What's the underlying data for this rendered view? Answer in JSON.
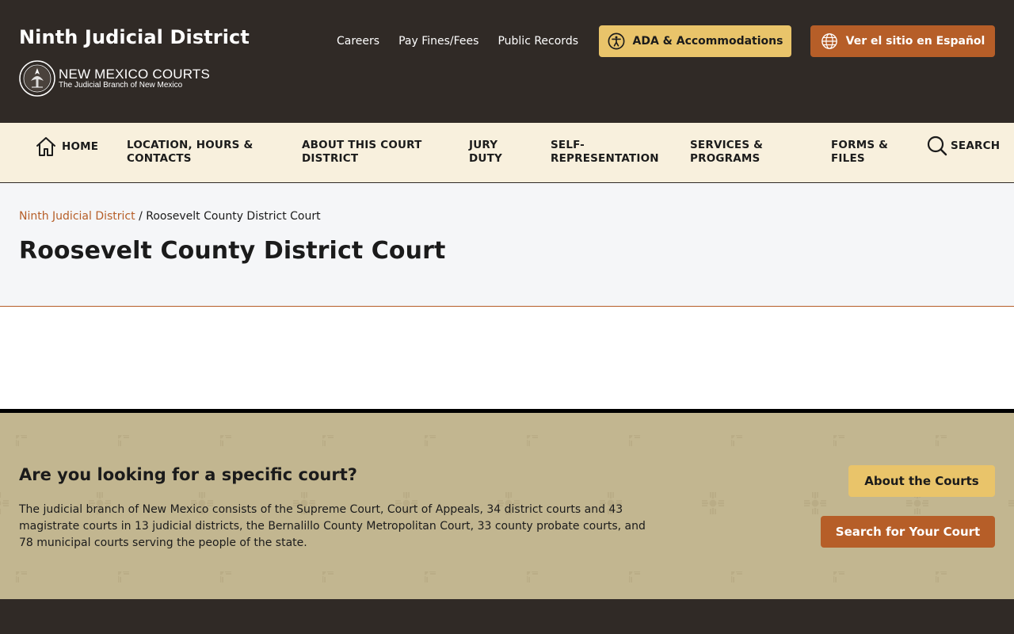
{
  "header": {
    "district_title": "Ninth Judicial District",
    "logo_main": "NEW MEXICO COURTS",
    "logo_sub": "The Judicial Branch of New Mexico",
    "utility_links": [
      "Careers",
      "Pay Fines/Fees",
      "Public Records"
    ],
    "ada_label": "ADA & Accommodations",
    "espanol_label": "Ver el sitio en Español",
    "ada_icon": "accessibility-icon",
    "espanol_icon": "globe-icon"
  },
  "nav": {
    "home": "HOME",
    "location_line1": "LOCATION, HOURS &",
    "location_line2": "CONTACTS",
    "about_line1": "ABOUT THIS COURT",
    "about_line2": "DISTRICT",
    "jury_line1": "JURY",
    "jury_line2": "DUTY",
    "self_line1": "SELF-",
    "self_line2": "REPRESENTATION",
    "services_line1": "SERVICES &",
    "services_line2": "PROGRAMS",
    "forms_line1": "FORMS &",
    "forms_line2": "FILES",
    "search": "SEARCH"
  },
  "banner": {
    "breadcrumb_parent": "Ninth Judicial District",
    "breadcrumb_sep": " / ",
    "breadcrumb_current": "Roosevelt County District Court",
    "page_title": "Roosevelt County District Court"
  },
  "cta": {
    "heading": "Are you looking for a specific court?",
    "text": "The judicial branch of New Mexico consists of the Supreme Court, Court of Appeals, 34 district courts and 43 magistrate courts in 13 judicial districts, the Bernalillo County Metropolitan Court, 33 county probate courts, and 78 municipal courts serving the people of the state.",
    "about_label": "About the Courts",
    "search_label": "Search for Your Court"
  },
  "colors": {
    "dark": "#302a26",
    "gold": "#e9c46a",
    "rust": "#b65e28",
    "cream": "#f8f0dd",
    "tan": "#c2b690"
  }
}
